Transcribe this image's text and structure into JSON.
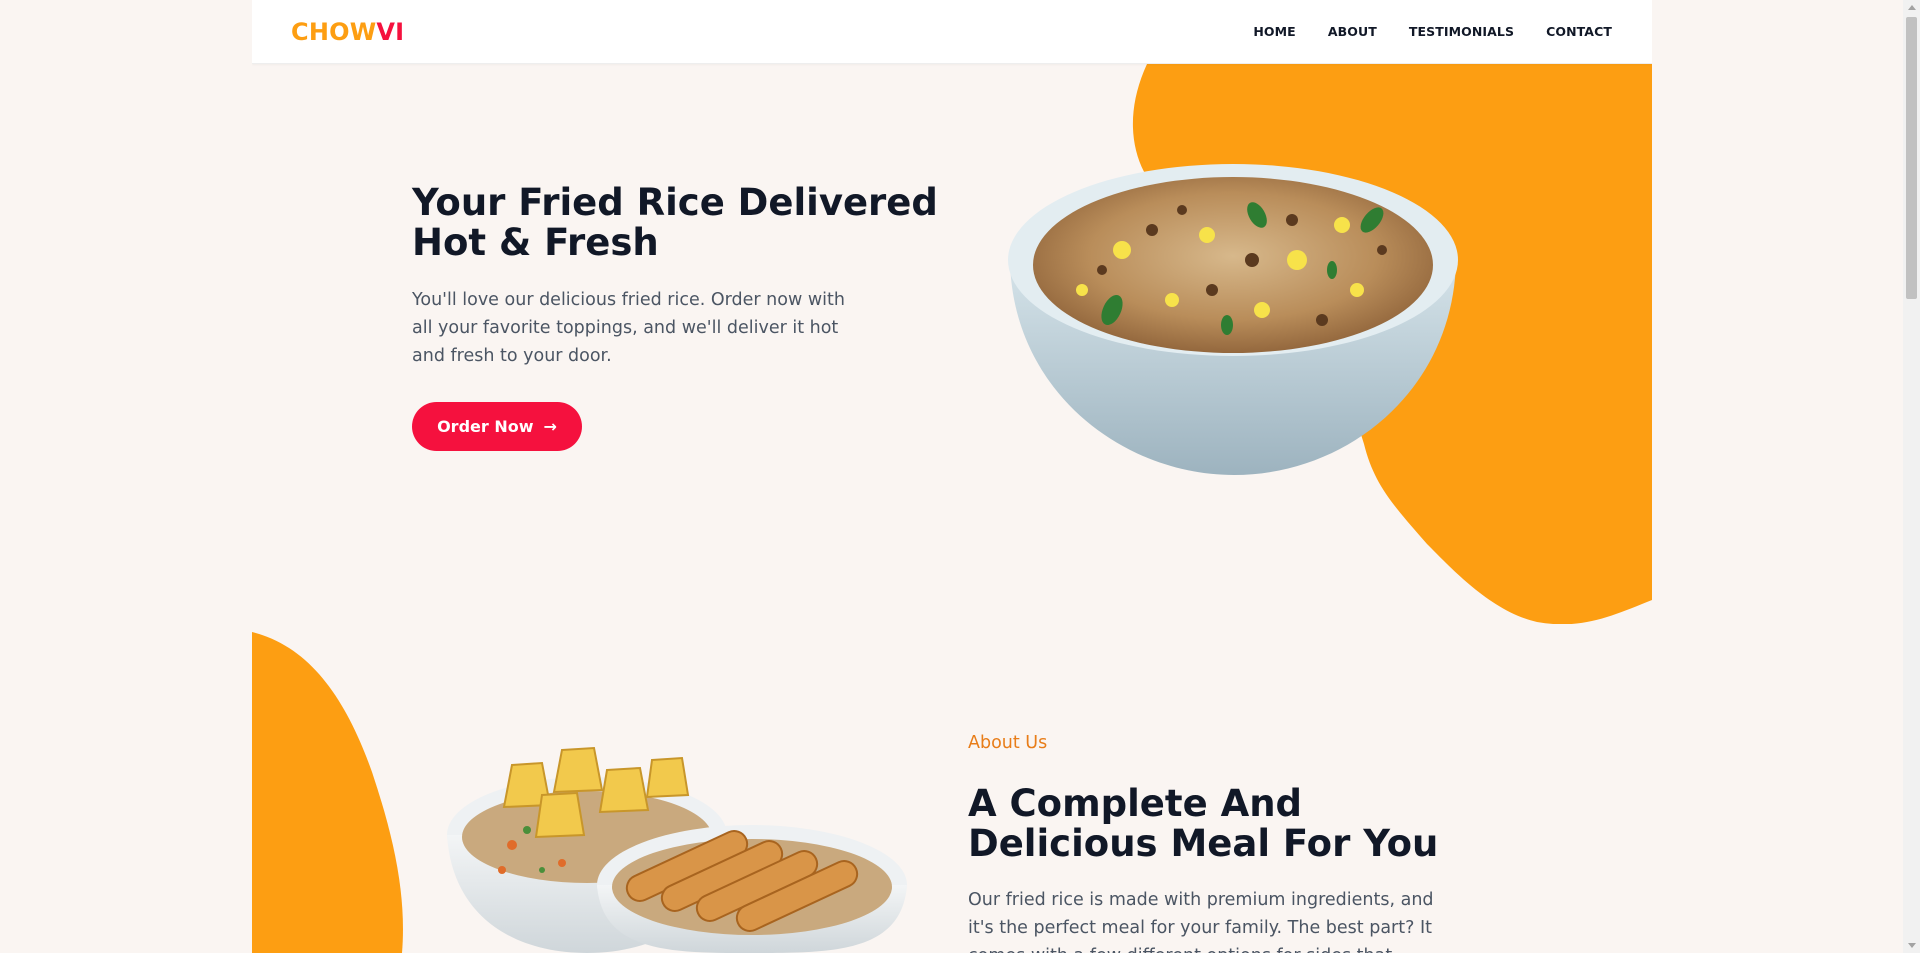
{
  "colors": {
    "brand_orange": "#fd9e12",
    "brand_red": "#f5113e",
    "background": "#faf5f2",
    "heading": "#111827",
    "body_text": "#4b5563",
    "eyebrow": "#e87d19"
  },
  "nav": {
    "logo_part1": "CHOW",
    "logo_part2": "VI",
    "links": [
      {
        "label": "HOME"
      },
      {
        "label": "ABOUT"
      },
      {
        "label": "TESTIMONIALS"
      },
      {
        "label": "CONTACT"
      }
    ]
  },
  "hero": {
    "title": "Your Fried Rice Delivered Hot & Fresh",
    "description": "You'll love our delicious fried rice. Order now with all your favorite toppings, and we'll deliver it hot and fresh to your door.",
    "button_label": "Order Now",
    "button_icon": "arrow-right-icon",
    "image_icon": "fried-rice-bowl-image"
  },
  "about": {
    "eyebrow": "About Us",
    "title": "A Complete And Delicious Meal For You",
    "description": "Our fried rice is made with premium ingredients, and it's the perfect meal for your family. The best part? It comes with a few different options for sides that",
    "image_icon": "fried-rice-combo-image"
  }
}
